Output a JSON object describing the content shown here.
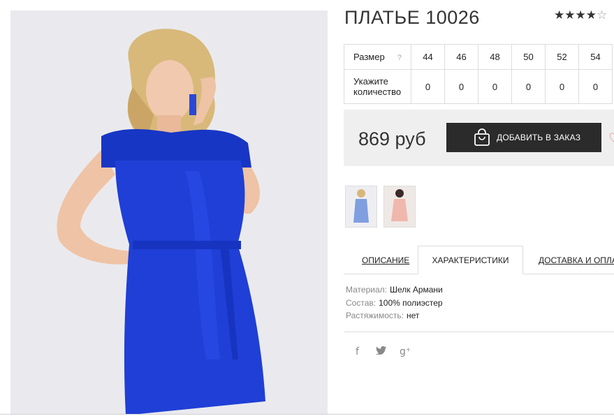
{
  "product": {
    "title": "ПЛАТЬЕ 10026",
    "rating": 4,
    "rating_max": 5
  },
  "sizes": {
    "size_label": "Размер",
    "help_mark": "?",
    "quantity_label": "Укажите количество",
    "columns": [
      {
        "size": "44",
        "qty": "0"
      },
      {
        "size": "46",
        "qty": "0"
      },
      {
        "size": "48",
        "qty": "0"
      },
      {
        "size": "50",
        "qty": "0"
      },
      {
        "size": "52",
        "qty": "0"
      },
      {
        "size": "54",
        "qty": "0"
      }
    ]
  },
  "purchase": {
    "price": "869 руб",
    "add_button": "ДОБАВИТЬ В ЗАКАЗ"
  },
  "tabs": {
    "description": "ОПИСАНИЕ",
    "characteristics": "ХАРАКТЕРИСТИКИ",
    "delivery": "ДОСТАВКА И ОПЛАТА"
  },
  "characteristics": [
    {
      "key": "Материал:",
      "value": "Шелк Армани"
    },
    {
      "key": "Состав:",
      "value": "100% полиэстер"
    },
    {
      "key": "Растяжимость:",
      "value": "нет"
    }
  ],
  "social": [
    "facebook-icon",
    "twitter-icon",
    "google-plus-icon"
  ],
  "social_glyphs": {
    "facebook": "f",
    "twitter": "🐦",
    "google": "g⁺"
  },
  "colors": {
    "dress_blue": "#1f3fd6",
    "button_dark": "#2b2b2b",
    "price_box": "#efefef",
    "heart": "#d96a7a"
  }
}
